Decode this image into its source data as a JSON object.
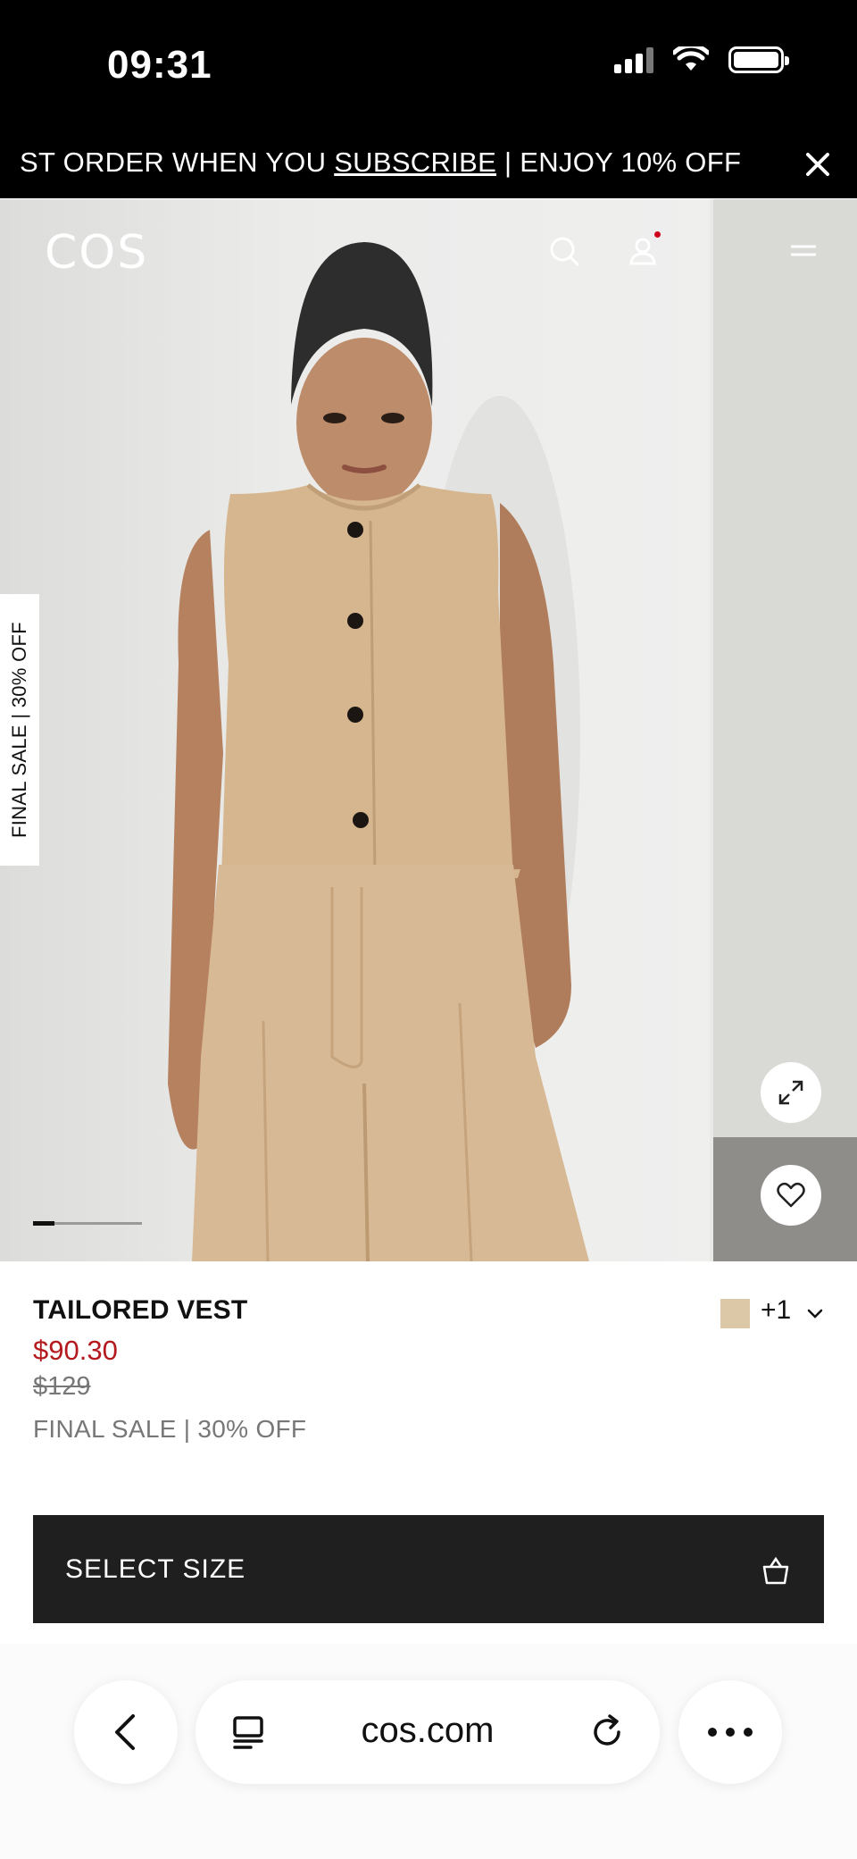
{
  "status_bar": {
    "time": "09:31"
  },
  "promo": {
    "text_before": "ST ORDER WHEN YOU ",
    "link": "SUBSCRIBE",
    "text_after": " | ENJOY 10% OFF"
  },
  "header": {
    "logo": "COS"
  },
  "gallery": {
    "side_tag": "FINAL SALE | 30% OFF",
    "current_slide_fraction": 0.2
  },
  "product": {
    "name": "TAILORED VEST",
    "sale_price": "$90.30",
    "original_price": "$129",
    "sale_note": "FINAL SALE | 30% OFF",
    "swatch_color": "#dcc7a7",
    "more_colors": "+1"
  },
  "actions": {
    "select_size": "SELECT SIZE"
  },
  "browser": {
    "url": "cos.com"
  },
  "colors": {
    "sale_red": "#b3191d",
    "button_dark": "#1f1f1f",
    "notification": "#d0021b"
  }
}
